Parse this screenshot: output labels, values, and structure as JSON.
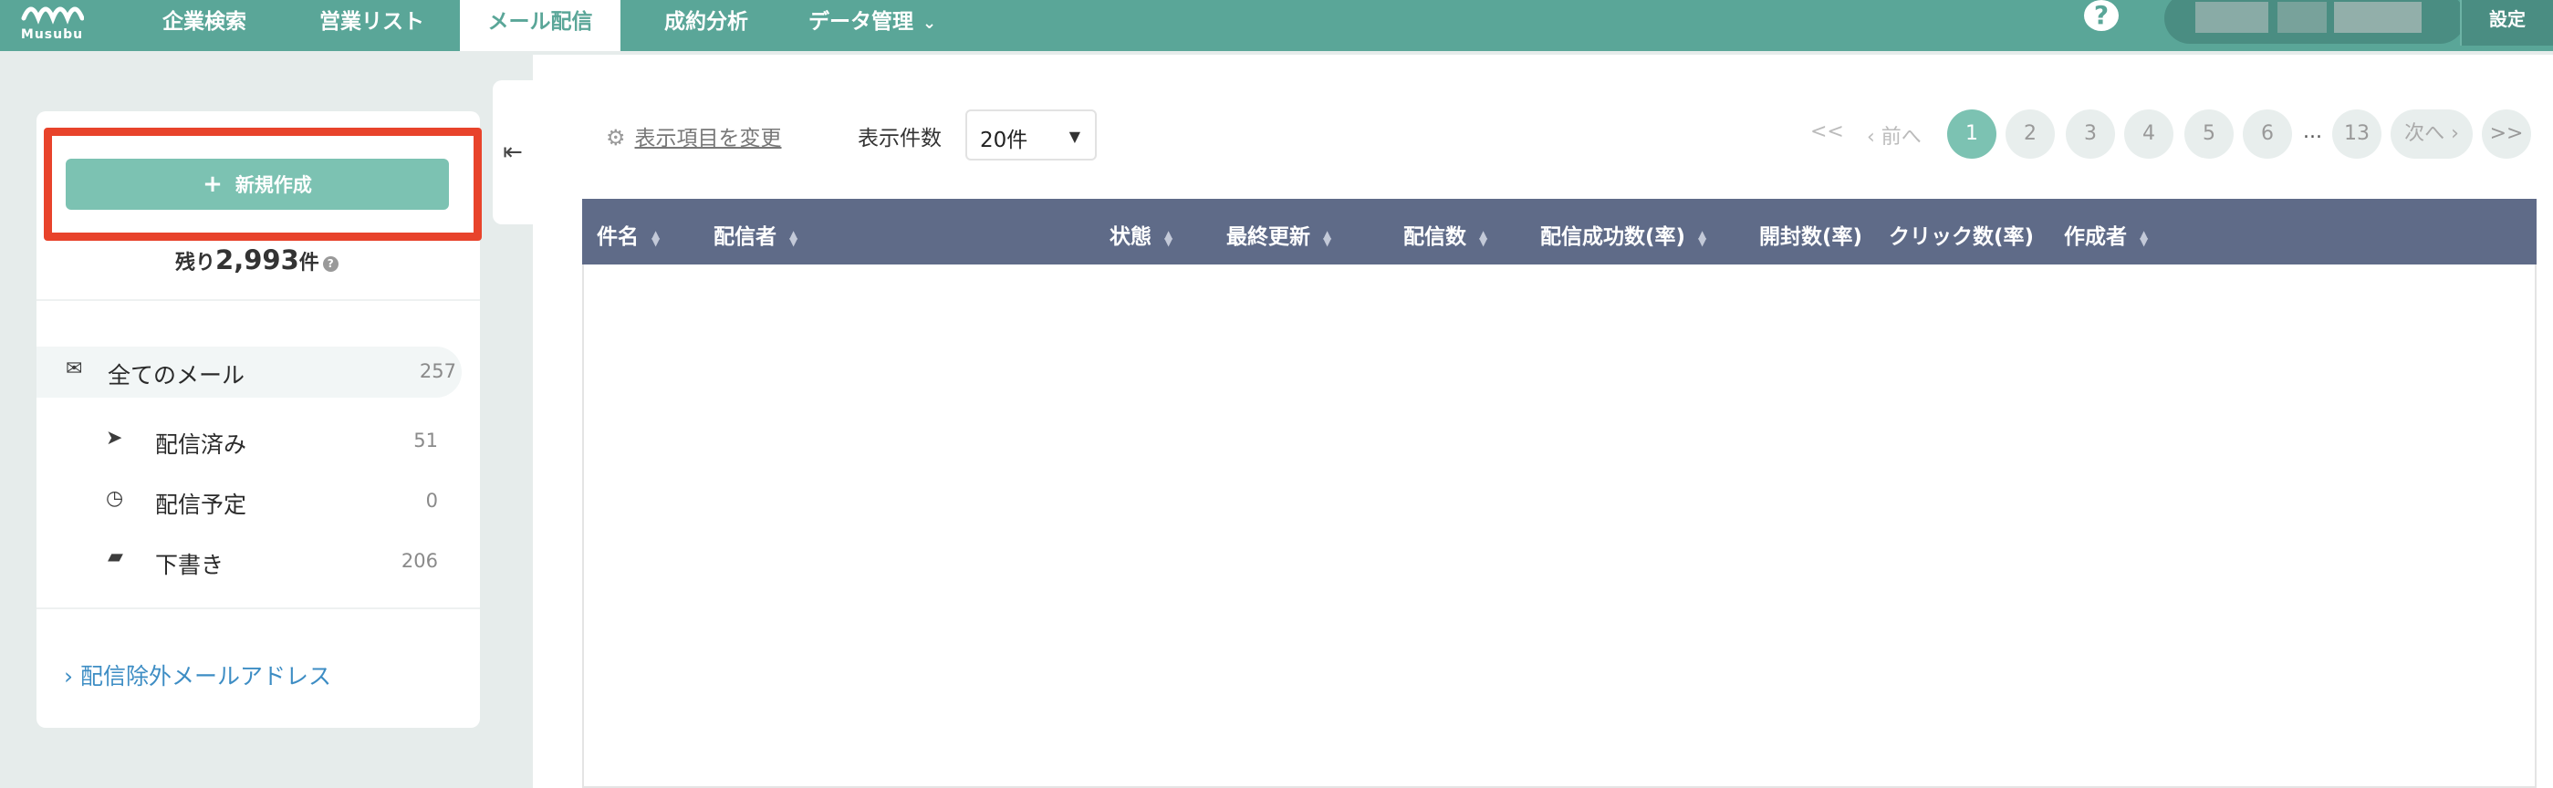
{
  "brand": {
    "name": "Musubu"
  },
  "nav": {
    "items": [
      "企業検索",
      "営業リスト",
      "メール配信",
      "成約分析",
      "データ管理"
    ],
    "active_index": 2,
    "settings_label": "設定"
  },
  "sidebar": {
    "new_button_label": "新規作成",
    "remaining_prefix": "残り",
    "remaining_count": "2,993",
    "remaining_suffix": "件",
    "items": [
      {
        "label": "全てのメール",
        "count": "257",
        "icon": "envelope-icon"
      },
      {
        "label": "配信済み",
        "count": "51",
        "icon": "paper-plane-icon"
      },
      {
        "label": "配信予定",
        "count": "0",
        "icon": "clock-icon"
      },
      {
        "label": "下書き",
        "count": "206",
        "icon": "document-icon"
      }
    ],
    "exclude_link": "配信除外メールアドレス"
  },
  "toolbar": {
    "column_settings_label": "表示項目を変更",
    "per_page_label": "表示件数",
    "per_page_value": "20件"
  },
  "pagination": {
    "first": "<<",
    "prev": "前へ",
    "pages": [
      "1",
      "2",
      "3",
      "4",
      "5",
      "6"
    ],
    "ellipsis": "...",
    "last_page": "13",
    "next": "次へ",
    "last": ">>",
    "current_page": "1"
  },
  "table": {
    "columns": [
      "件名",
      "配信者",
      "状態",
      "最終更新",
      "配信数",
      "配信成功数(率)",
      "開封数(率)",
      "クリック数(率)",
      "作成者"
    ],
    "rows": []
  },
  "colors": {
    "accent": "#5aa698",
    "button": "#7cc2b2",
    "highlight": "#e8432b",
    "table_header": "#5f6b88",
    "link": "#3d8dc4"
  }
}
